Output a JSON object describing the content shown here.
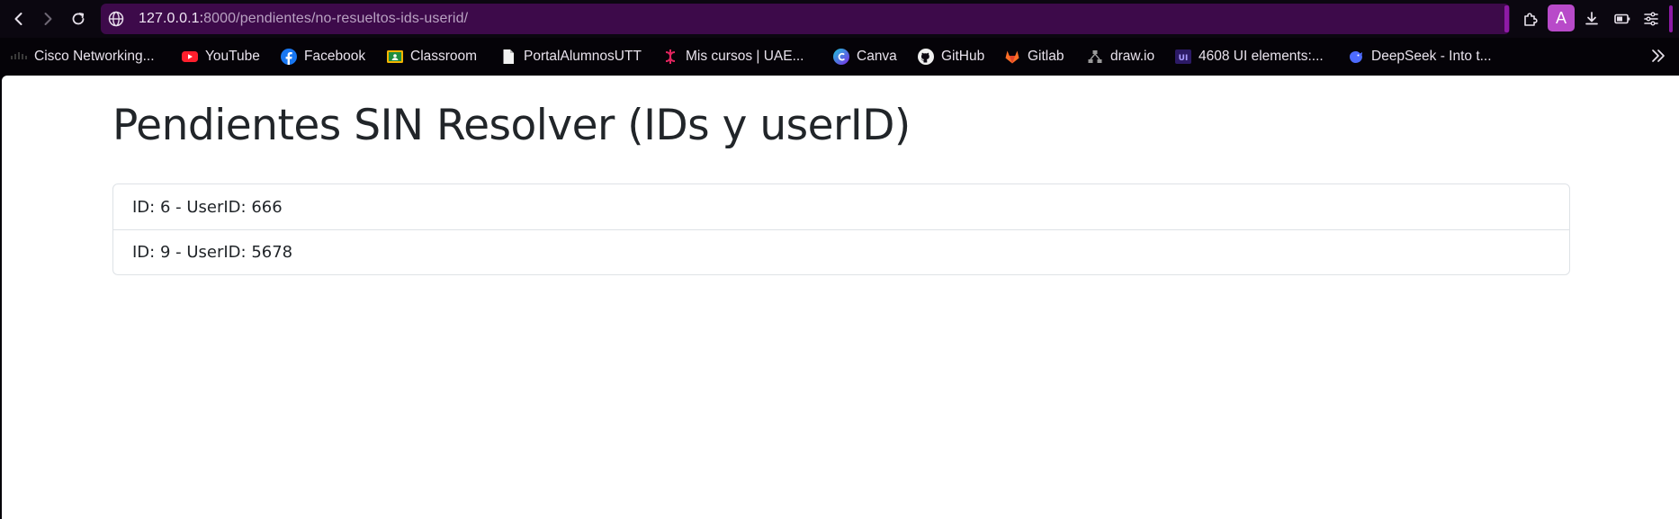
{
  "browser": {
    "url_host": "127.0.0.1:",
    "url_path": "8000/pendientes/no-resueltos-ids-userid/",
    "avatar_letter": "A",
    "accent_color": "#3d0a4a",
    "avatar_color": "#b84ac9",
    "icons": [
      "back-icon",
      "forward-icon",
      "reload-icon",
      "globe-icon",
      "extensions-icon",
      "download-icon",
      "battery-icon",
      "menu-icon"
    ]
  },
  "bookmarks": [
    {
      "label": "Cisco Networking...",
      "icon": "cisco-icon"
    },
    {
      "label": "YouTube",
      "icon": "youtube-icon"
    },
    {
      "label": "Facebook",
      "icon": "facebook-icon"
    },
    {
      "label": "Classroom",
      "icon": "classroom-icon"
    },
    {
      "label": "PortalAlumnosUTT",
      "icon": "document-icon"
    },
    {
      "label": "Mis cursos | UAE...",
      "icon": "uae-icon"
    },
    {
      "label": "Canva",
      "icon": "canva-icon"
    },
    {
      "label": "GitHub",
      "icon": "github-icon"
    },
    {
      "label": "Gitlab",
      "icon": "gitlab-icon"
    },
    {
      "label": "draw.io",
      "icon": "drawio-icon"
    },
    {
      "label": "4608 UI elements:...",
      "icon": "ui-icon"
    },
    {
      "label": "DeepSeek - Into t...",
      "icon": "deepseek-icon"
    }
  ],
  "page": {
    "title": "Pendientes SIN Resolver (IDs y userID)",
    "items": [
      "ID: 6 - UserID: 666",
      "ID: 9 - UserID: 5678"
    ]
  }
}
